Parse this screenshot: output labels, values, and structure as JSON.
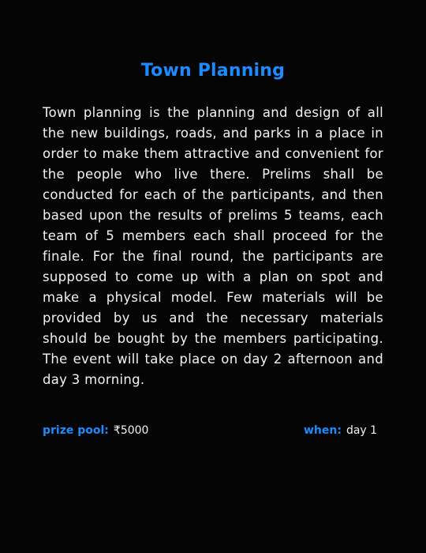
{
  "title": "Town Planning",
  "description": "Town planning is the planning and design of all the new buildings, roads, and parks in a place in order to make them attractive and convenient for the people who live there. Prelims shall be conducted for each of the participants, and then based upon the results of prelims 5 teams, each team of 5 members each shall proceed for the finale. For the final round, the participants are supposed to come up with a plan on spot and make a physical model.  Few materials will be provided by us and the necessary materials should be bought by the members participating. The event will take place on day 2 afternoon and day 3 morning.",
  "prize": {
    "label": "prize pool:",
    "value": "₹5000"
  },
  "when": {
    "label": "when:",
    "value": "day 1"
  },
  "colors": {
    "background": "#050505",
    "accent": "#1a8cff",
    "text": "#f2f2f2"
  }
}
